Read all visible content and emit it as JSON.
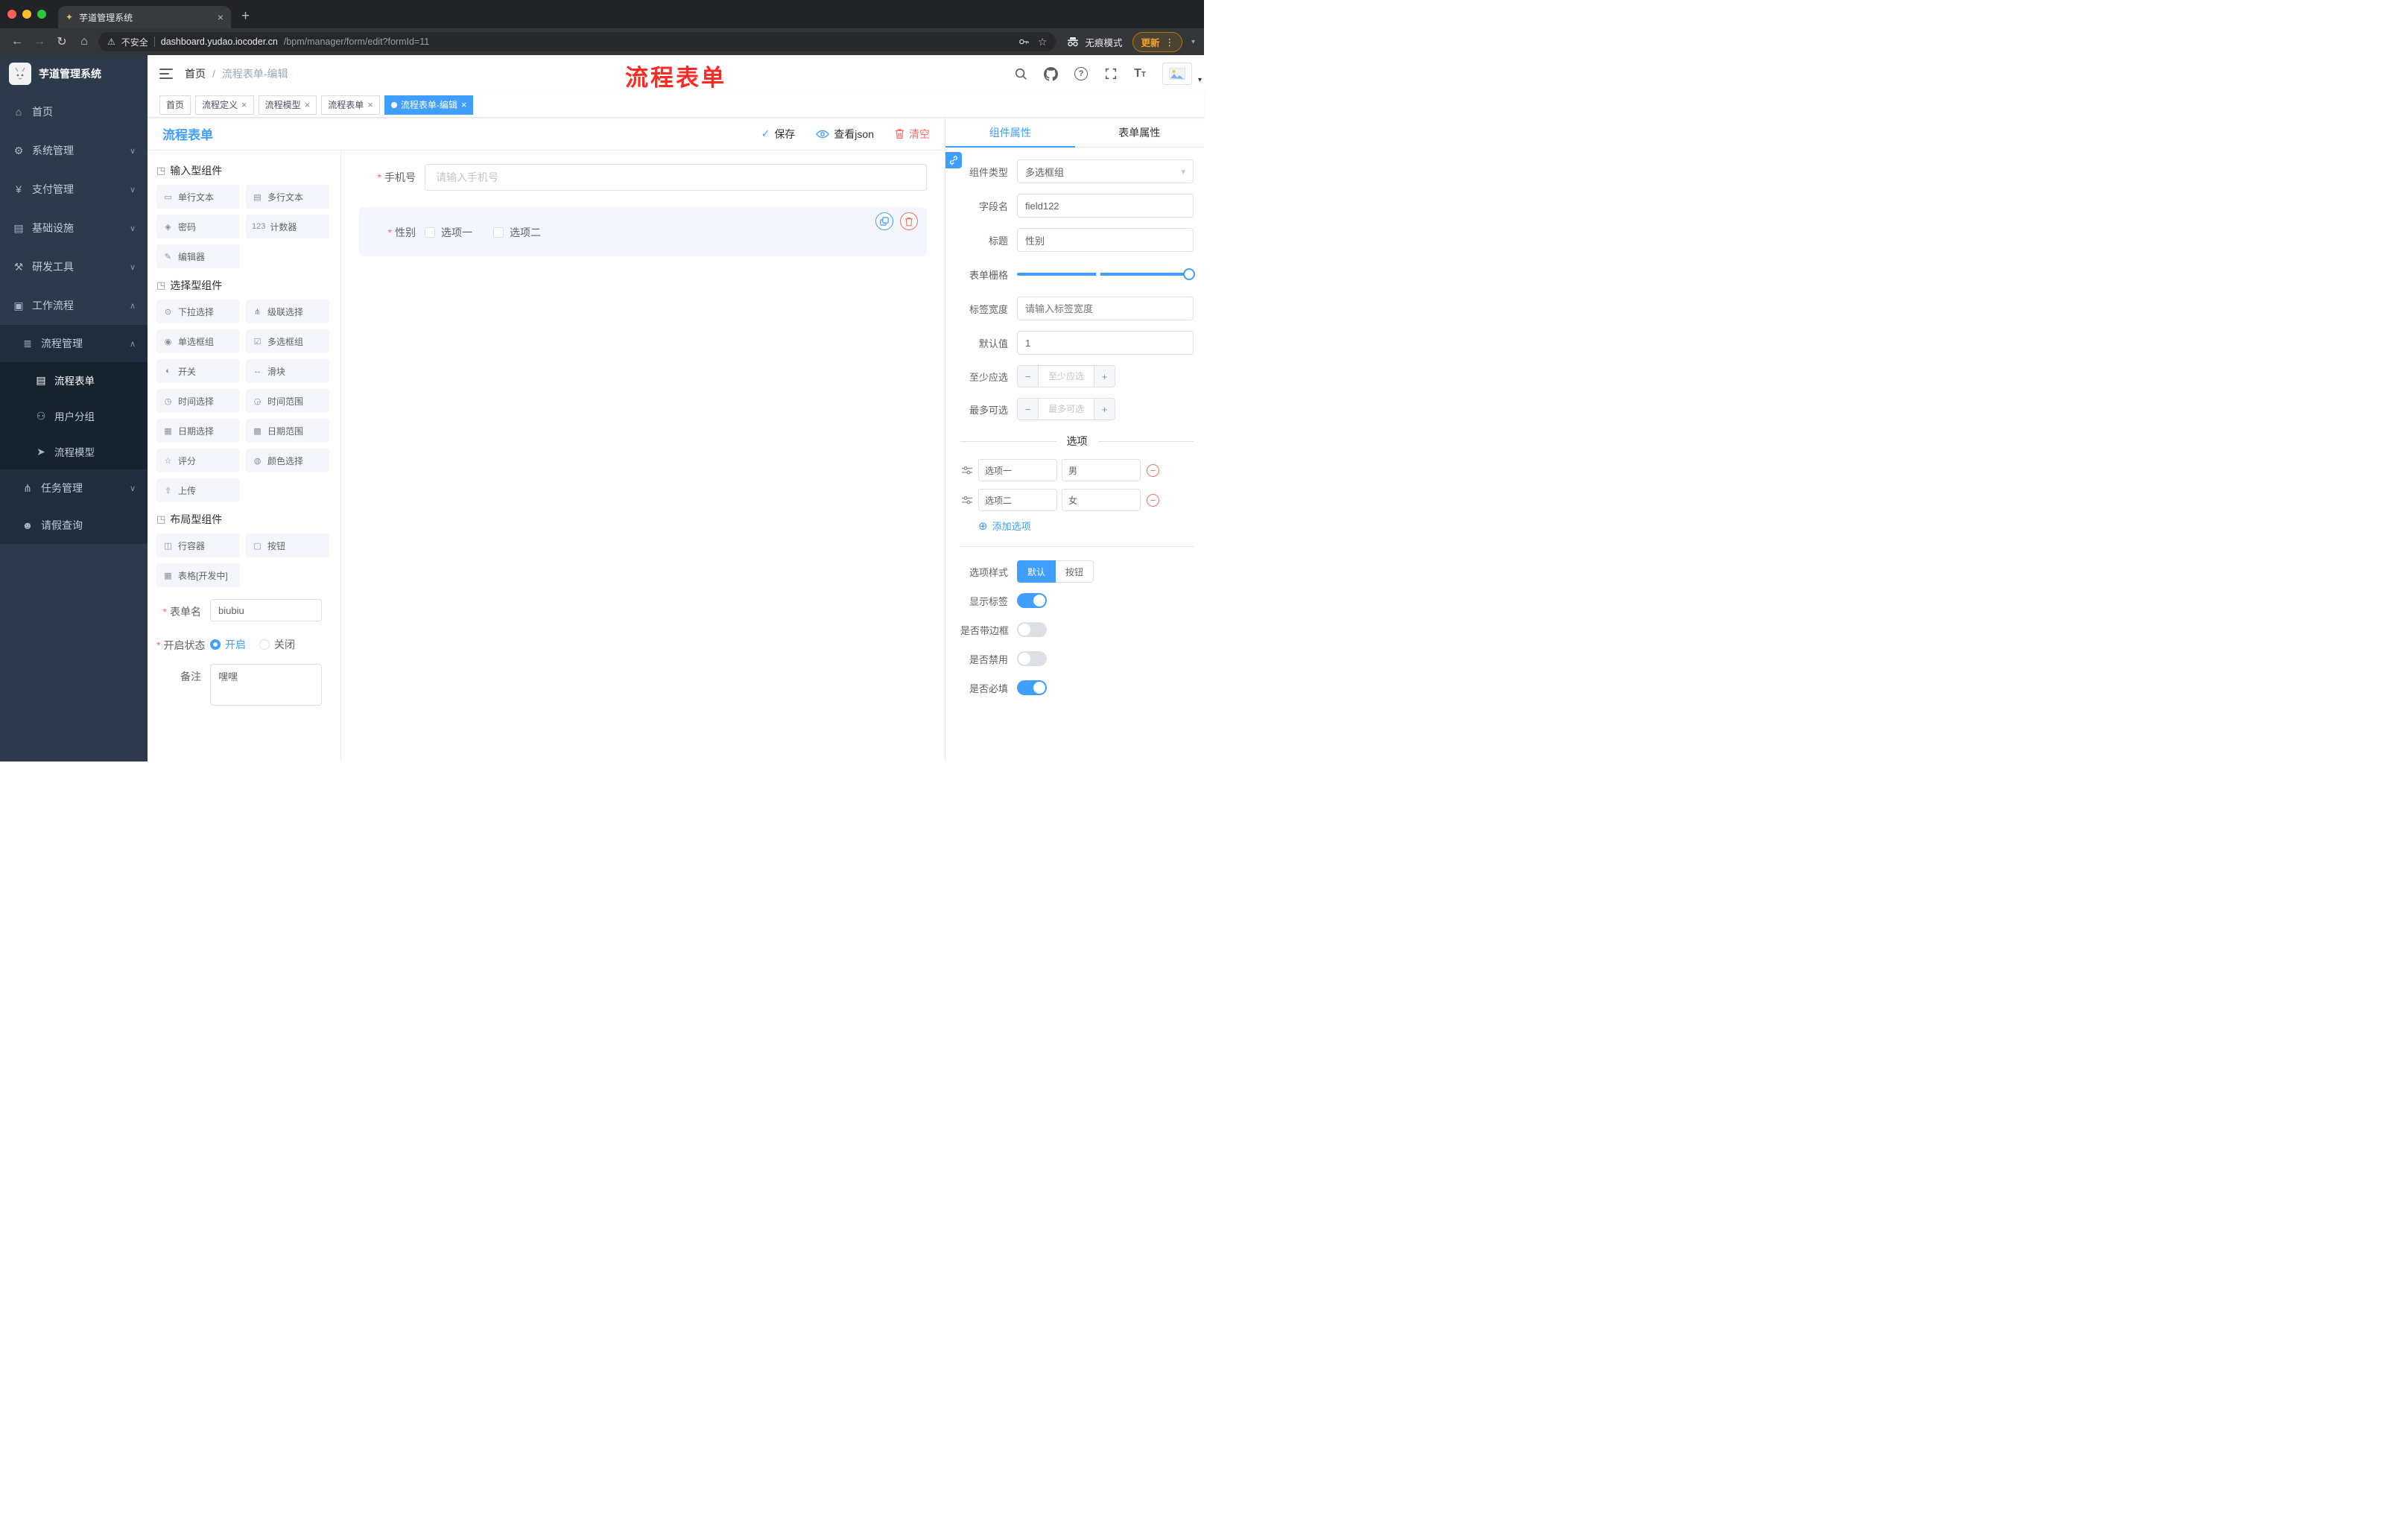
{
  "browser": {
    "tab_title": "芋道管理系统",
    "security_label": "不安全",
    "url_host": "dashboard.yudao.iocoder.cn",
    "url_path": "/bpm/manager/form/edit?formId=11",
    "incognito_label": "无痕模式",
    "update_label": "更新"
  },
  "sidebar": {
    "app_title": "芋道管理系统",
    "menu": [
      {
        "label": "首页",
        "icon": "⌂"
      },
      {
        "label": "系统管理",
        "icon": "⚙"
      },
      {
        "label": "支付管理",
        "icon": "¥"
      },
      {
        "label": "基础设施",
        "icon": "▤"
      },
      {
        "label": "研发工具",
        "icon": "⚒"
      },
      {
        "label": "工作流程",
        "icon": "▣"
      },
      {
        "label": "流程管理",
        "icon": "≣"
      },
      {
        "label": "流程表单",
        "icon": "▤"
      },
      {
        "label": "用户分组",
        "icon": "⚇"
      },
      {
        "label": "流程模型",
        "icon": "➤"
      },
      {
        "label": "任务管理",
        "icon": "⋔"
      },
      {
        "label": "请假查询",
        "icon": "☻"
      }
    ]
  },
  "header": {
    "breadcrumb_home": "首页",
    "breadcrumb_sep": "/",
    "breadcrumb_current": "流程表单-编辑",
    "annotation": "流程表单"
  },
  "tags": [
    {
      "label": "首页"
    },
    {
      "label": "流程定义"
    },
    {
      "label": "流程模型"
    },
    {
      "label": "流程表单"
    },
    {
      "label": "流程表单-编辑"
    }
  ],
  "designer": {
    "title": "流程表单",
    "actions": {
      "save": "保存",
      "view_json": "查看json",
      "clear": "清空"
    },
    "palette": {
      "groups": [
        {
          "title": "输入型组件",
          "items": [
            {
              "label": "单行文本",
              "icon": "▭"
            },
            {
              "label": "多行文本",
              "icon": "▤"
            },
            {
              "label": "密码",
              "icon": "◈"
            },
            {
              "label": "计数器",
              "icon": "123"
            },
            {
              "label": "编辑器",
              "icon": "✎"
            }
          ]
        },
        {
          "title": "选择型组件",
          "items": [
            {
              "label": "下拉选择",
              "icon": "⊙"
            },
            {
              "label": "级联选择",
              "icon": "⋔"
            },
            {
              "label": "单选框组",
              "icon": "◉"
            },
            {
              "label": "多选框组",
              "icon": "☑"
            },
            {
              "label": "开关",
              "icon": "◐"
            },
            {
              "label": "滑块",
              "icon": "↔"
            },
            {
              "label": "时间选择",
              "icon": "◷"
            },
            {
              "label": "时间范围",
              "icon": "◶"
            },
            {
              "label": "日期选择",
              "icon": "▦"
            },
            {
              "label": "日期范围",
              "icon": "▩"
            },
            {
              "label": "评分",
              "icon": "☆"
            },
            {
              "label": "颜色选择",
              "icon": "◍"
            },
            {
              "label": "上传",
              "icon": "⇧"
            }
          ]
        },
        {
          "title": "布局型组件",
          "items": [
            {
              "label": "行容器",
              "icon": "◫"
            },
            {
              "label": "按钮",
              "icon": "▢"
            },
            {
              "label": "表格[开发中]",
              "icon": "▦"
            }
          ]
        }
      ]
    },
    "config": {
      "form_name_label": "表单名",
      "form_name_value": "biubiu",
      "status_label": "开启状态",
      "status_on": "开启",
      "status_off": "关闭",
      "remark_label": "备注",
      "remark_value": "嘿嘿"
    },
    "canvas": {
      "phone_label": "手机号",
      "phone_placeholder": "请输入手机号",
      "gender_label": "性别",
      "gender_option1": "选项一",
      "gender_option2": "选项二"
    }
  },
  "properties": {
    "tab_component": "组件属性",
    "tab_form": "表单属性",
    "component_type_label": "组件类型",
    "component_type_value": "多选框组",
    "field_name_label": "字段名",
    "field_name_value": "field122",
    "title_label": "标题",
    "title_value": "性别",
    "grid_label": "表单栅格",
    "label_width_label": "标签宽度",
    "label_width_placeholder": "请输入标签宽度",
    "default_label": "默认值",
    "default_value": "1",
    "min_label": "至少应选",
    "min_placeholder": "至少应选",
    "max_label": "最多可选",
    "max_placeholder": "最多可选",
    "options_title": "选项",
    "option_rows": [
      {
        "label": "选项一",
        "value": "男"
      },
      {
        "label": "选项二",
        "value": "女"
      }
    ],
    "add_option": "添加选项",
    "style_label": "选项样式",
    "style_default": "默认",
    "style_button": "按钮",
    "switch_show_label": {
      "label": "显示标签",
      "on": true
    },
    "switch_border": {
      "label": "是否带边框",
      "on": false
    },
    "switch_disabled": {
      "label": "是否禁用",
      "on": false
    },
    "switch_required": {
      "label": "是否必填",
      "on": true
    }
  },
  "colors": {
    "accent": "#409eff",
    "danger": "#f56c6c",
    "annotation_red": "#fe2b24",
    "update_orange": "#f5a623",
    "sidebar_bg": "#2d3a4b"
  }
}
